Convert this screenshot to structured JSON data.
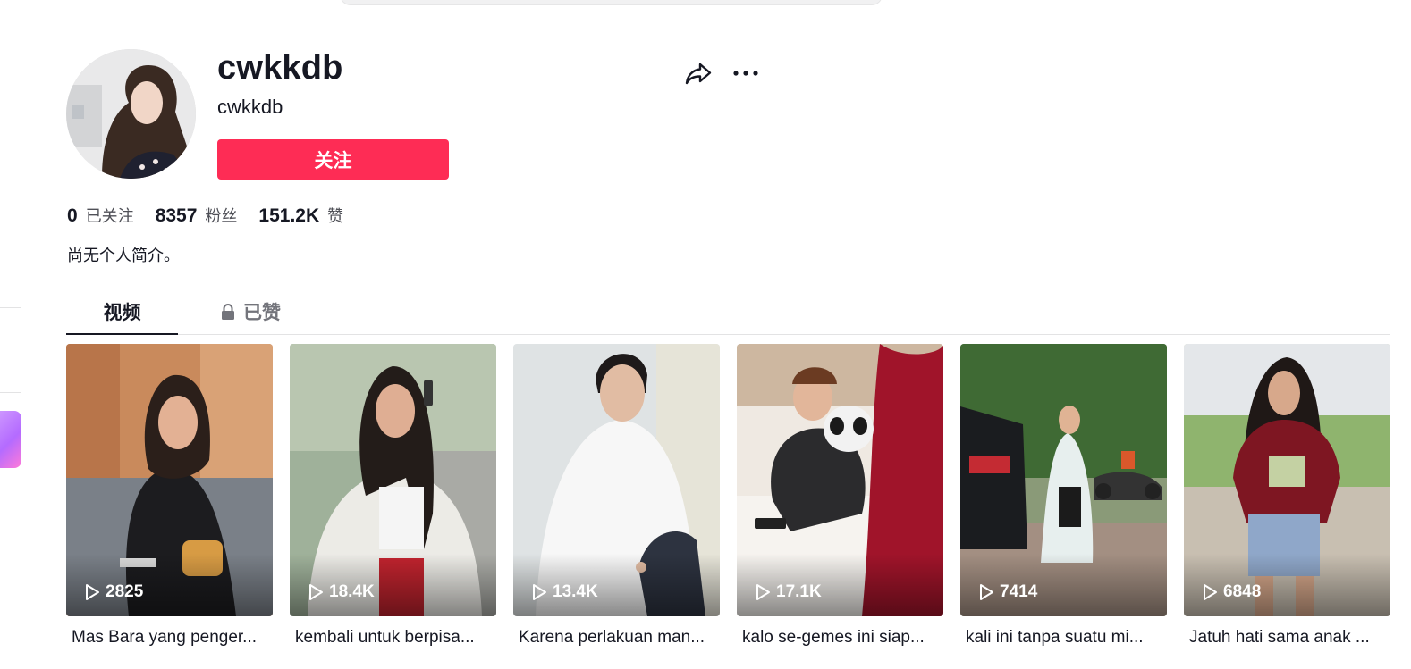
{
  "profile": {
    "username": "cwkkdb",
    "handle": "cwkkdb",
    "follow_label": "关注",
    "bio": "尚无个人简介。",
    "stats": [
      {
        "value": "0",
        "label": "已关注"
      },
      {
        "value": "8357",
        "label": "粉丝"
      },
      {
        "value": "151.2K",
        "label": "赞"
      }
    ]
  },
  "icons": {
    "share": "share-icon",
    "more": "more-icon",
    "lock": "lock-icon",
    "play": "play-icon"
  },
  "tabs": [
    {
      "label": "视频",
      "active": true
    },
    {
      "label": "已赞",
      "locked": true
    }
  ],
  "colors": {
    "accent": "#fe2c55",
    "text": "#161823",
    "muted": "#73747b"
  },
  "videos": [
    {
      "plays": "2825",
      "caption": "Mas Bara yang penger..."
    },
    {
      "plays": "18.4K",
      "caption": "kembali untuk berpisa..."
    },
    {
      "plays": "13.4K",
      "caption": "Karena perlakuan man..."
    },
    {
      "plays": "17.1K",
      "caption": "kalo se-gemes ini siap..."
    },
    {
      "plays": "7414",
      "caption": "kali ini tanpa suatu mi..."
    },
    {
      "plays": "6848",
      "caption": "Jatuh hati sama anak ..."
    }
  ]
}
